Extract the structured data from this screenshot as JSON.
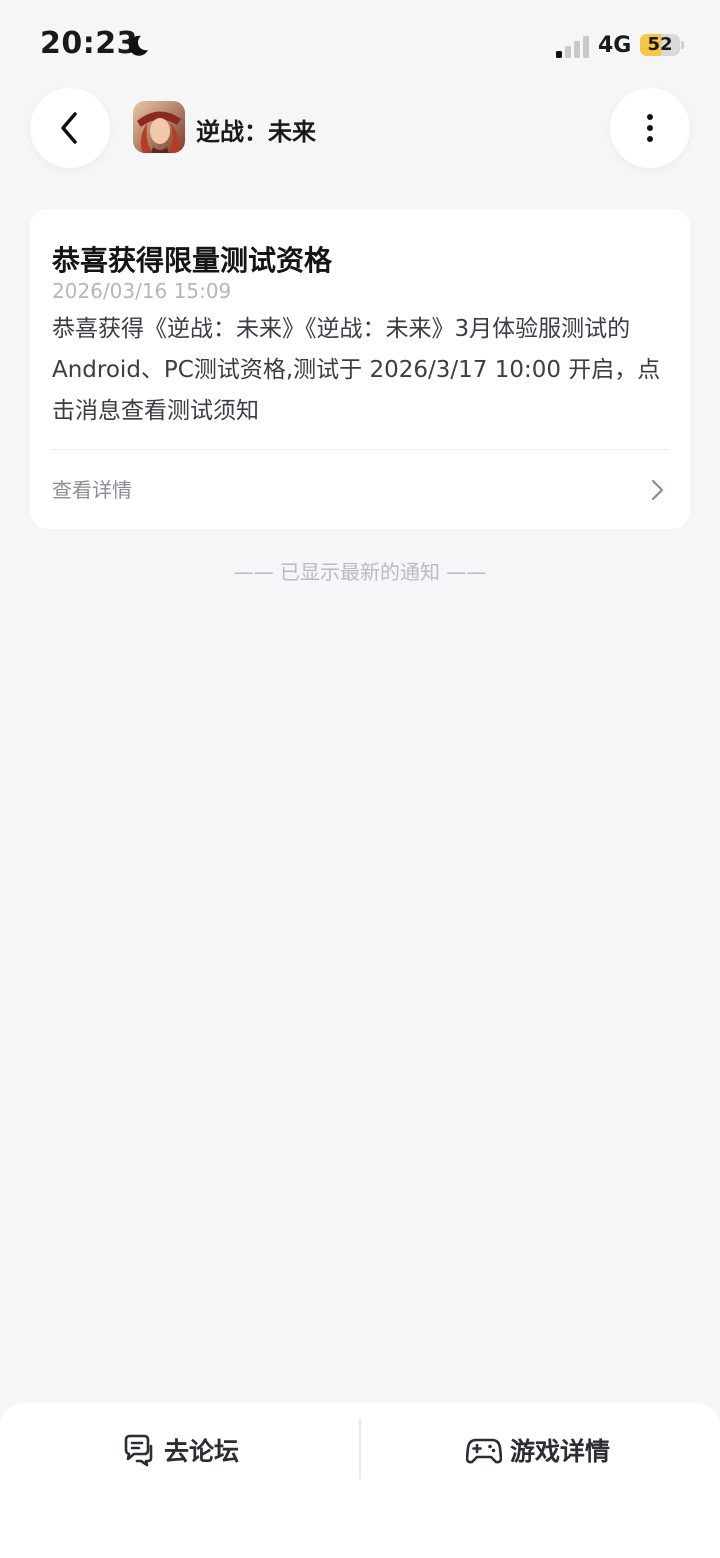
{
  "status_bar": {
    "time": "20:23",
    "moon_icon": "moon-icon",
    "signal_icon": "cellular-signal-icon",
    "network": "4G",
    "battery_level": "52",
    "battery_fraction": 0.52,
    "battery_color": "#f5c842"
  },
  "header": {
    "back_icon": "chevron-left-icon",
    "game_icon": "game-avatar-icon",
    "game_title": "逆战：未来",
    "more_icon": "more-vertical-icon"
  },
  "notification": {
    "title": "恭喜获得限量测试资格",
    "date": "2026/03/16 15:09",
    "body": "恭喜获得《逆战：未来》《逆战：未来》3月体验服测试的Android、PC测试资格,测试于 2026/3/17 10:00 开启，点击消息查看测试须知",
    "detail_label": "查看详情",
    "detail_icon": "chevron-right-icon"
  },
  "end_notice": "—— 已显示最新的通知 ——",
  "bottom_bar": {
    "forum_icon": "chat-bubbles-icon",
    "forum_label": "去论坛",
    "game_icon": "gamepad-icon",
    "game_label": "游戏详情"
  },
  "colors": {
    "background": "#f5f6f8",
    "card": "#ffffff",
    "muted_text": "#b3b6bd"
  }
}
